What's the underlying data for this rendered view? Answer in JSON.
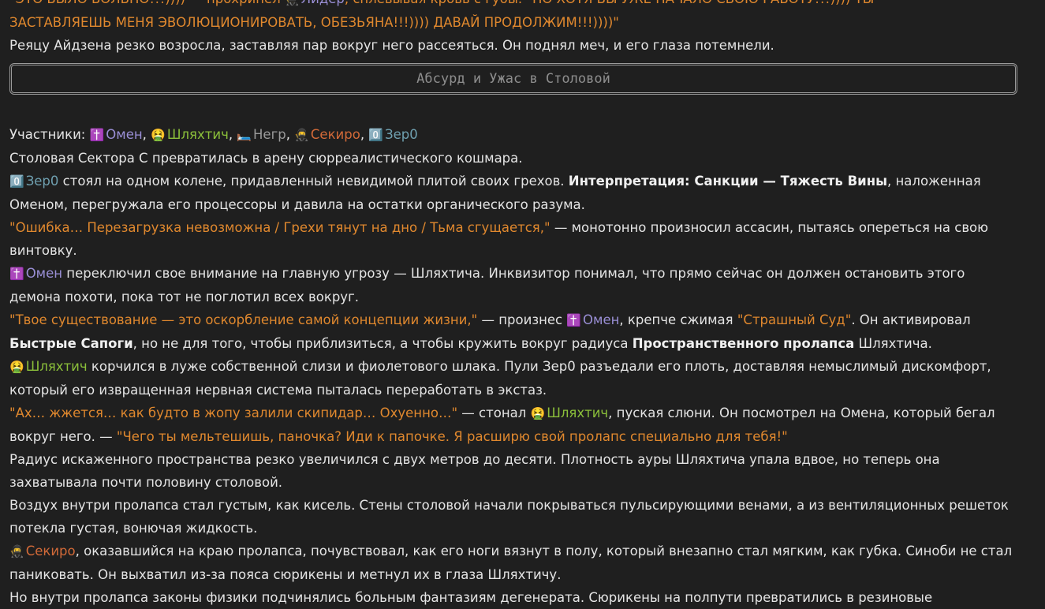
{
  "top": {
    "l1_a": "\"ЭТО БЫЛО БОЛЬНО!!!)))) — прохрипел",
    "l1_name": "Лидер",
    "l1_b": ", сплевывая кровь с губы. \"НО ХОТЯ БЫ УЖЕ НАЧАЛО СВОЮ РАБОТУ!!!)))) ТЫ",
    "l2": "ЗАСТАВЛЯЕШЬ МЕНЯ ЭВОЛЮЦИОНИРОВАТЬ, ОБЕЗЬЯНА!!!)))) ДАВАЙ ПРОДОЛЖИМ!!!))))\"",
    "l3": "Реяцу Айдзена резко возросла, заставляя пар вокруг него рассеяться. Он поднял меч, и его глаза потемнели."
  },
  "section_title": "Абсурд и Ужас в Столовой",
  "participants": {
    "label": "Участники:",
    "items": [
      {
        "icon": "✝️",
        "name": "Омен"
      },
      {
        "icon": "🤮",
        "name": "Шляхтич"
      },
      {
        "icon": "🛏️",
        "name": "Негр"
      },
      {
        "icon": "🥷",
        "name": "Секиро"
      },
      {
        "icon": "0️⃣",
        "name": "Зер0"
      }
    ]
  },
  "story": {
    "p1": "Столовая Сектора С превратилась в арену сюрреалистического кошмара.",
    "p2_name": "Зер0",
    "p2_a": " стоял на одном колене, придавленный невидимой плитой своих грехов. ",
    "p2_bold": "Интерпретация: Санкции — Тяжесть Вины",
    "p2_b": ", наложенная",
    "p2_c": "Оменом, перегружала его процессоры и давила на остатки органического разума.",
    "p3_quote": "\"Ошибка… Перезагрузка невозможна / Грехи тянут на дно / Тьма сгущается,\"",
    "p3_a": " — монотонно произносил ассасин, пытаясь опереться на свою",
    "p3_b": "винтовку.",
    "p4_name": "Омен",
    "p4_a": " переключил свое внимание на главную угрозу — Шляхтича. Инквизитор понимал, что прямо сейчас он должен остановить этого",
    "p4_b": "демона похоти, пока тот не поглотил всех вокруг.",
    "p5_quote": "\"Твое существование — это оскорбление самой концепции жизни,\"",
    "p5_a": " — произнес ",
    "p5_name": "Омен",
    "p5_b": ", крепче сжимая ",
    "p5_quote2": "\"Страшный Суд\"",
    "p5_c": ". Он активировал",
    "p5_bold1": "Быстрые Сапоги",
    "p5_d": ", но не для того, чтобы приблизиться, а чтобы кружить вокруг радиуса ",
    "p5_bold2": "Пространственного пролапса",
    "p5_e": " Шляхтича.",
    "p6_name": "Шляхтич",
    "p6_a": " корчился в луже собственной слизи и фиолетового шлака. Пули Зер0 разъедали его плоть, доставляя немыслимый дискомфорт,",
    "p6_b": "который его извращенная нервная система пыталась переработать в экстаз.",
    "p7_quote": "\"Ах… жжется… как будто в жопу залили скипидар… Охуенно…\"",
    "p7_a": " — стонал ",
    "p7_name": "Шляхтич",
    "p7_b": ", пуская слюни. Он посмотрел на Омена, который бегал",
    "p7_c": "вокруг него. — ",
    "p7_quote2": "\"Чего ты мельтешишь, паночка? Иди к папочке. Я расширю свой пролапс специально для тебя!\"",
    "p8_a": "Радиус искаженного пространства резко увеличился с двух метров до десяти. Плотность ауры Шляхтича упала вдвое, но теперь она",
    "p8_b": "захватывала почти половину столовой.",
    "p9_a": "Воздух внутри пролапса стал густым, как кисель. Стены столовой начали покрываться пульсирующими венами, а из вентиляционных решеток",
    "p9_b": "потекла густая, вонючая жидкость.",
    "p10_name": "Секиро",
    "p10_a": ", оказавшийся на краю пролапса, почувствовал, как его ноги вязнут в полу, который внезапно стал мягким, как губка. Синоби не стал",
    "p10_b": "паниковать. Он выхватил из-за пояса сюрикены и метнул их в глаза Шляхтичу.",
    "p11": "Но внутри пролапса законы физики подчинялись больным фантазиям дегенерата. Сюрикены на полпути превратились в резиновые"
  }
}
